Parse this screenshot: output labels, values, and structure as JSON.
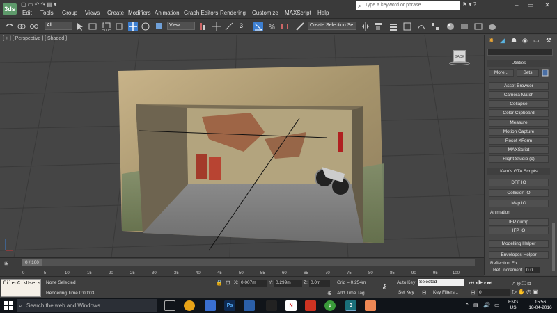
{
  "menubar": {
    "app_icon": "3ds",
    "items": [
      "Edit",
      "Tools",
      "Group",
      "Views",
      "Create",
      "Modifiers",
      "Animation",
      "Graph Editors",
      "Rendering",
      "Customize",
      "MAXScript",
      "Help"
    ],
    "search_placeholder": "Type a keyword or phrase"
  },
  "toolbar": {
    "selection_filter": "All",
    "ref_coord": "View",
    "named_selection": "Create Selection Se",
    "snap_value": "3"
  },
  "viewport": {
    "label": "[ + ] [ Perspective ] [ Shaded ]",
    "viewcube_label": "BACK"
  },
  "cmdpanel": {
    "utilities_title": "Utilities",
    "more_label": "More...",
    "sets_label": "Sets",
    "utility_buttons": [
      "Asset Browser",
      "Camera Match",
      "Collapse",
      "Color Clipboard",
      "Measure",
      "Motion Capture",
      "Reset XForm",
      "MAXScript",
      "Flight Studio (c)"
    ],
    "gta_title": "Kam's GTA Scripts",
    "gta_buttons": [
      "DFF IO",
      "Collision IO",
      "Map IO"
    ],
    "animation_label": "Animation",
    "anim_buttons": [
      "IFP dump",
      "IFP IO"
    ],
    "helper_buttons": [
      "Modelling Helper",
      "Envelopes Helper"
    ],
    "reflection_label": "Reflection Fix",
    "ref_increment_label": "Ref. increment",
    "ref_increment_value": "0.0"
  },
  "timeline": {
    "slider_label": "0 / 100",
    "ticks": [
      "0",
      "5",
      "10",
      "15",
      "20",
      "25",
      "30",
      "35",
      "40",
      "45",
      "50",
      "55",
      "60",
      "65",
      "70",
      "75",
      "80",
      "85",
      "90",
      "95",
      "100"
    ]
  },
  "statusbar": {
    "maxscript_text": "file:C:\\Users",
    "selection_status": "None Selected",
    "render_time": "Rendering Time  0:00:03",
    "x_label": "X:",
    "x_value": "0.007m",
    "y_label": "Y:",
    "y_value": "0.299m",
    "z_label": "Z:",
    "z_value": "0.0m",
    "grid": "Grid = 0.254m",
    "add_time_tag": "Add Time Tag",
    "auto_key": "Auto Key",
    "auto_key_mode": "Selected",
    "set_key": "Set Key",
    "key_filters": "Key Filters...",
    "frame_value": "0"
  },
  "taskbar": {
    "search_text": "Search the web and Windows",
    "lang_top": "ENG",
    "lang_bottom": "US",
    "time": "15:56",
    "date": "18-04-2016"
  },
  "colors": {
    "viewport_bg": "#454545",
    "highlight": "#3d7fd1"
  }
}
